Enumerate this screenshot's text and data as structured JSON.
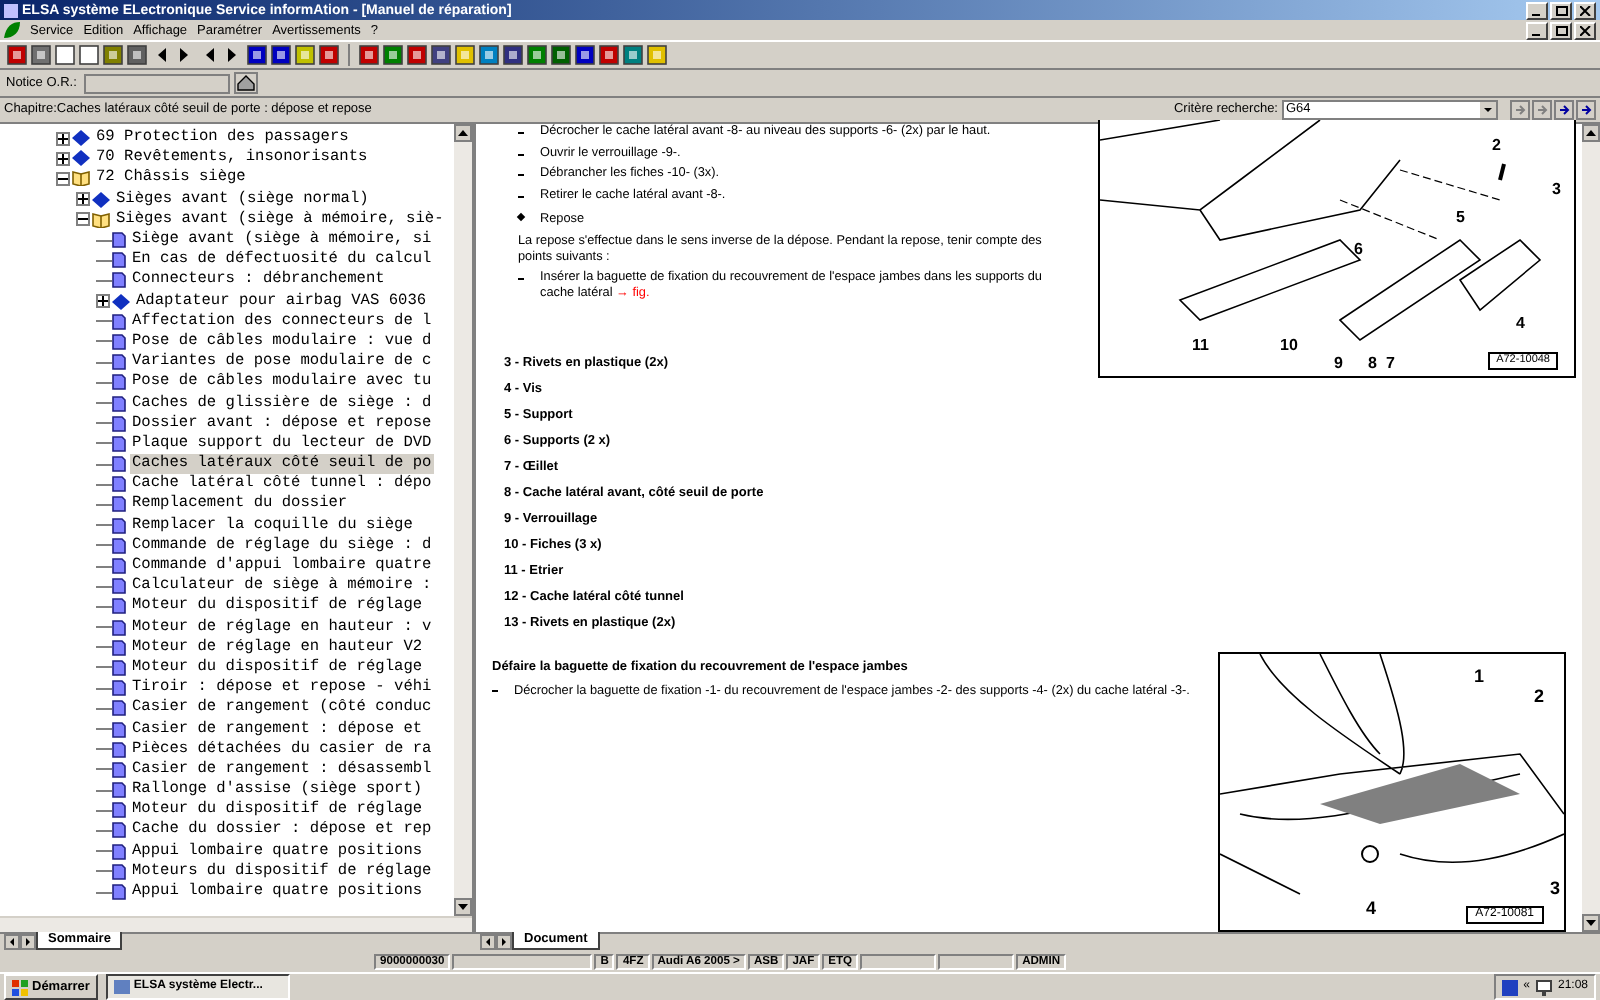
{
  "window": {
    "title": "ELSA système ELectronique Service informAtion - [Manuel de réparation]"
  },
  "menu": [
    {
      "label": "Service"
    },
    {
      "label": "Edition"
    },
    {
      "label": "Affichage"
    },
    {
      "label": "Paramétrer"
    },
    {
      "label": "Avertissements"
    },
    {
      "label": "?"
    }
  ],
  "notice": {
    "label": "Notice O.R.:"
  },
  "chapter": {
    "label": "Chapitre:Caches latéraux côté seuil de porte : dépose et repose"
  },
  "search": {
    "label": "Critère recherche:",
    "value": "G64"
  },
  "tree": [
    {
      "label": "69 Protection des passagers",
      "kind": "chapter",
      "expanded": false,
      "selected": false
    },
    {
      "label": "70 Revêtements, insonorisants",
      "kind": "chapter",
      "expanded": false,
      "selected": false
    },
    {
      "label": "72 Châssis siège",
      "kind": "chapter",
      "expanded": true,
      "selected": false,
      "children": [
        {
          "label": "Sièges avant (siège normal)",
          "kind": "chapter",
          "expanded": false,
          "selected": false
        },
        {
          "label": "Sièges avant (siège à mémoire, siè-",
          "kind": "chapter",
          "expanded": true,
          "selected": false,
          "children": [
            {
              "label": "Siège avant (siège à mémoire, si",
              "kind": "page",
              "selected": false
            },
            {
              "label": "En cas de défectuosité du calcul",
              "kind": "page",
              "selected": false
            },
            {
              "label": "Connecteurs : débranchement",
              "kind": "page",
              "selected": false
            },
            {
              "label": "Adaptateur pour airbag VAS 6036",
              "kind": "chapter",
              "expanded": false,
              "selected": false
            },
            {
              "label": "Affectation des connecteurs de l",
              "kind": "page",
              "selected": false
            },
            {
              "label": "Pose de câbles modulaire : vue d",
              "kind": "page",
              "selected": false
            },
            {
              "label": "Variantes de pose modulaire de c",
              "kind": "page",
              "selected": false
            },
            {
              "label": "Pose de câbles modulaire avec tu",
              "kind": "page",
              "selected": false
            },
            {
              "label": "Caches de glissière de siège : d",
              "kind": "page",
              "selected": false
            },
            {
              "label": "Dossier avant : dépose et repose",
              "kind": "page",
              "selected": false
            },
            {
              "label": "Plaque support du lecteur de DVD",
              "kind": "page",
              "selected": false
            },
            {
              "label": "Caches latéraux côté seuil de po",
              "kind": "page",
              "selected": true
            },
            {
              "label": "Cache latéral côté tunnel : dépo",
              "kind": "page",
              "selected": false
            },
            {
              "label": "Remplacement du dossier",
              "kind": "page",
              "selected": false
            },
            {
              "label": "Remplacer la coquille du siège",
              "kind": "page",
              "selected": false
            },
            {
              "label": "Commande de réglage du siège : d",
              "kind": "page",
              "selected": false
            },
            {
              "label": "Commande d'appui lombaire quatre",
              "kind": "page",
              "selected": false
            },
            {
              "label": "Calculateur de siège à mémoire :",
              "kind": "page",
              "selected": false
            },
            {
              "label": "Moteur du dispositif de réglage",
              "kind": "page",
              "selected": false
            },
            {
              "label": "Moteur de réglage en hauteur : v",
              "kind": "page",
              "selected": false
            },
            {
              "label": "Moteur de réglage en hauteur  V2",
              "kind": "page",
              "selected": false
            },
            {
              "label": "Moteur du dispositif de réglage",
              "kind": "page",
              "selected": false
            },
            {
              "label": "Tiroir : dépose et repose - véhi",
              "kind": "page",
              "selected": false
            },
            {
              "label": "Casier de rangement (côté conduc",
              "kind": "page",
              "selected": false
            },
            {
              "label": "Casier de rangement : dépose et",
              "kind": "page",
              "selected": false
            },
            {
              "label": "Pièces détachées du casier de ra",
              "kind": "page",
              "selected": false
            },
            {
              "label": "Casier de rangement : désassembl",
              "kind": "page",
              "selected": false
            },
            {
              "label": "Rallonge d'assise (siège sport)",
              "kind": "page",
              "selected": false
            },
            {
              "label": "Moteur du dispositif de réglage",
              "kind": "page",
              "selected": false
            },
            {
              "label": "Cache du dossier : dépose et rep",
              "kind": "page",
              "selected": false
            },
            {
              "label": "Appui lombaire quatre positions",
              "kind": "page",
              "selected": false
            },
            {
              "label": "Moteurs du dispositif de réglage",
              "kind": "page",
              "selected": false
            },
            {
              "label": "Appui lombaire quatre positions",
              "kind": "page",
              "selected": false
            }
          ]
        }
      ]
    }
  ],
  "left_tabs": [
    {
      "label": "Sommaire",
      "selected": true
    }
  ],
  "document": {
    "blocks": [
      {
        "kind": "dash",
        "text": "Décrocher le cache latéral avant -8- au niveau des supports -6- (2x) par le haut."
      },
      {
        "kind": "dash",
        "text": "Ouvrir le verrouillage -9-."
      },
      {
        "kind": "dash",
        "text": "Débrancher les fiches -10- (3x)."
      },
      {
        "kind": "dash",
        "text": "Retirer le cache latéral avant -8-."
      },
      {
        "kind": "bullet",
        "text": "Repose"
      },
      {
        "kind": "para",
        "text": "La repose s'effectue dans le sens inverse de la dépose. Pendant la repose, tenir compte des points suivants :"
      },
      {
        "kind": "dash",
        "text": "Insérer la baguette de fixation du recouvrement de l'espace jambes dans les supports du cache latéral",
        "link": "→ fig."
      },
      {
        "kind": "item",
        "text": "3 - Rivets en plastique (2x)"
      },
      {
        "kind": "item",
        "text": "4 - Vis"
      },
      {
        "kind": "item",
        "text": "5 - Support"
      },
      {
        "kind": "item",
        "text": "6 - Supports (2 x)"
      },
      {
        "kind": "item",
        "text": "7 - Œillet"
      },
      {
        "kind": "item",
        "text": "8 - Cache latéral avant, côté seuil de porte"
      },
      {
        "kind": "item",
        "text": "9 - Verrouillage"
      },
      {
        "kind": "item",
        "text": "10 - Fiches (3 x)"
      },
      {
        "kind": "item",
        "text": "11 - Etrier"
      },
      {
        "kind": "item",
        "text": "12 - Cache latéral côté tunnel"
      },
      {
        "kind": "item",
        "text": "13 - Rivets en plastique (2x)"
      }
    ],
    "figure_1": {
      "callouts": [
        "2",
        "3",
        "5",
        "6",
        "4",
        "11",
        "10",
        "9",
        "8",
        "7"
      ],
      "code": "A72-10048"
    },
    "section": {
      "heading": "Défaire la baguette de fixation du recouvrement de l'espace jambes",
      "step": "Décrocher la baguette de fixation -1- du recouvrement de l'espace jambes -2- des supports -4- (2x) du cache latéral -3-."
    },
    "figure_2": {
      "callouts": [
        "1",
        "2",
        "3",
        "4"
      ],
      "code": "A72-10081"
    }
  },
  "right_tabs": [
    {
      "label": "Document",
      "selected": true
    }
  ],
  "status_bar": {
    "order_number": "9000000030",
    "fields": [
      "B",
      "4FZ",
      "Audi A6 2005 >",
      "ASB",
      "JAF",
      "ETQ"
    ],
    "user": "ADMIN"
  },
  "taskbar": {
    "start": "Démarrer",
    "task": "ELSA système Electr...",
    "tray_arrow": "«",
    "clock": "21:08"
  }
}
